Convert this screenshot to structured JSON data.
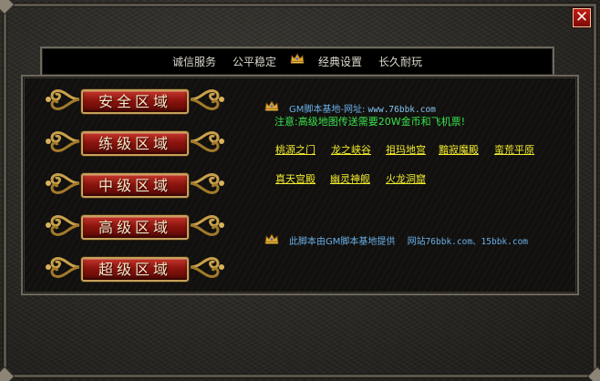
{
  "window": {
    "close_label": "✕"
  },
  "tabs": [
    {
      "label": "诚信服务"
    },
    {
      "label": "公平稳定"
    },
    {
      "label": "经典设置"
    },
    {
      "label": "长久耐玩"
    }
  ],
  "zones": [
    {
      "label": "安全区域"
    },
    {
      "label": "练级区域"
    },
    {
      "label": "中级区域"
    },
    {
      "label": "高级区域"
    },
    {
      "label": "超级区域"
    }
  ],
  "info": {
    "site_title": "GM脚本基地-网址:",
    "site_url": "www.76bbk.com",
    "notice": "注意:高级地图传送需要20W金币和飞机票!"
  },
  "maps_row1": [
    "桃源之门",
    "龙之峡谷",
    "祖玛地宫",
    "黯寂魔殿",
    "蛮荒平原"
  ],
  "maps_row2": [
    "真天宫殿",
    "幽灵神舰",
    "火龙洞窟"
  ],
  "credit": {
    "text": "此脚本由GM脚本基地提供",
    "site_prefix": "网站",
    "site_urls": "76bbk.com、15bbk.com"
  },
  "colors": {
    "notice_green": "#39e34c",
    "link_yellow": "#f2ec2c",
    "info_blue": "#6ab0e8",
    "button_red": "#8b140e"
  }
}
